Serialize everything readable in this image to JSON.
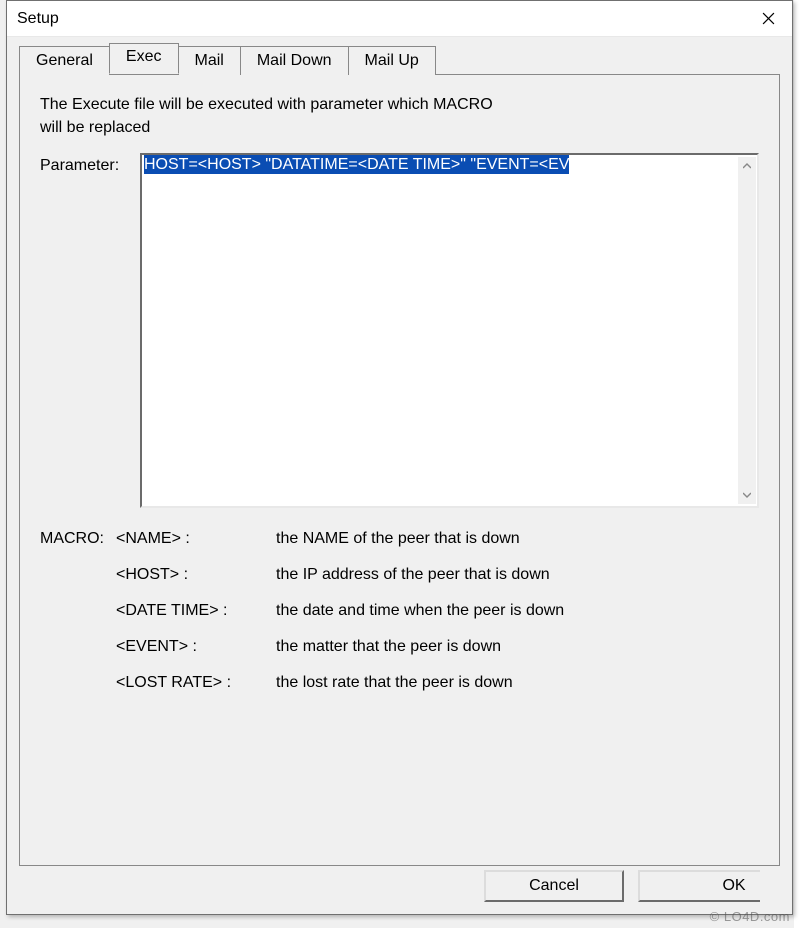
{
  "window": {
    "title": "Setup"
  },
  "tabs": [
    {
      "label": "General"
    },
    {
      "label": "Exec"
    },
    {
      "label": "Mail"
    },
    {
      "label": "Mail Down"
    },
    {
      "label": "Mail Up"
    }
  ],
  "active_tab_index": 1,
  "exec": {
    "intro_line1": "The Execute file  will be executed with parameter which MACRO",
    "intro_line2": "will be replaced",
    "parameter_label": "Parameter:",
    "parameter_value": "HOST=<HOST> \"DATATIME=<DATE TIME>\" \"EVENT=<EV",
    "macro_label": "MACRO:",
    "macros": [
      {
        "key": "<NAME> :",
        "desc": "the NAME of the peer that is down"
      },
      {
        "key": "<HOST> :",
        "desc": "the IP address of the peer that is down"
      },
      {
        "key": "<DATE TIME> :",
        "desc": "the date and time when the peer is down"
      },
      {
        "key": "<EVENT> :",
        "desc": "the matter that the peer is down"
      },
      {
        "key": "<LOST RATE> :",
        "desc": "the lost rate that the peer is down"
      }
    ]
  },
  "buttons": {
    "cancel": "Cancel",
    "ok": "OK"
  },
  "watermark": "© LO4D.com"
}
